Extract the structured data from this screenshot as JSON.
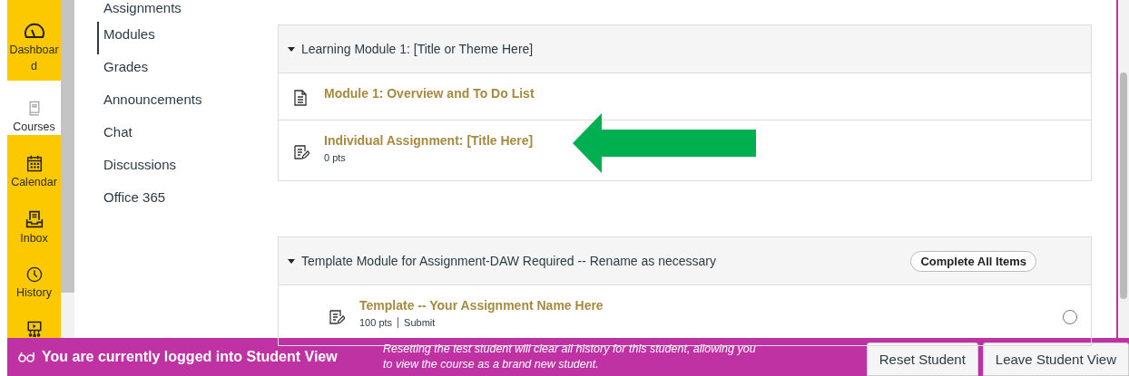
{
  "global_nav": [
    {
      "label": "Dashboard",
      "selected": false
    },
    {
      "label": "Courses",
      "selected": true
    },
    {
      "label": "Calendar",
      "selected": false
    },
    {
      "label": "Inbox",
      "selected": false
    },
    {
      "label": "History",
      "selected": false
    },
    {
      "selected": false
    }
  ],
  "course_nav": [
    {
      "label": "Assignments",
      "selected": false
    },
    {
      "label": "Modules",
      "selected": true
    },
    {
      "label": "Grades",
      "selected": false
    },
    {
      "label": "Announcements",
      "selected": false
    },
    {
      "label": "Chat",
      "selected": false
    },
    {
      "label": "Discussions",
      "selected": false
    },
    {
      "label": "Office 365",
      "selected": false
    }
  ],
  "modules": [
    {
      "title": "Learning Module 1: [Title or Theme Here]",
      "expanded": true,
      "items": [
        {
          "kind": "page",
          "title": "Module 1: Overview and To Do List",
          "indented": false
        },
        {
          "kind": "assignment",
          "title": "Individual Assignment: [Title Here]",
          "details": [
            "0 pts"
          ],
          "indented": false,
          "pointed": true
        }
      ]
    },
    {
      "title": "Template Module for Assignment-DAW Required -- Rename as necessary",
      "expanded": true,
      "button": "Complete All Items",
      "items": [
        {
          "kind": "assignment",
          "title": "Template -- Your Assignment Name Here",
          "details": [
            "100 pts",
            "Submit"
          ],
          "indented": true,
          "completed": false
        }
      ]
    }
  ],
  "student_view_bar": {
    "message": "You are currently logged into Student View",
    "note": "Resetting the test student will clear all history for this student, allowing you to view the course as a brand new student.",
    "buttons": [
      "Reset Student",
      "Leave Student View"
    ]
  }
}
